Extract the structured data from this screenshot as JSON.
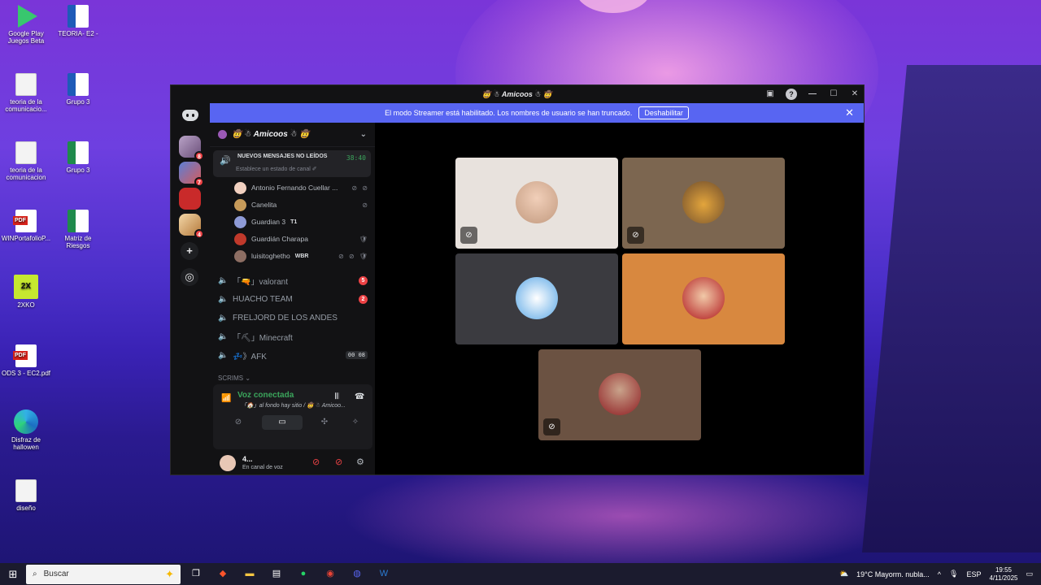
{
  "desktop": {
    "icons": [
      {
        "label": "Google Play Juegos Beta",
        "type": "gplay"
      },
      {
        "label": "TEORIA- E2 -",
        "type": "word"
      },
      {
        "label": "teoria de la comunicacio...",
        "type": "doc"
      },
      {
        "label": "Grupo 3",
        "type": "word"
      },
      {
        "label": "teoria de la comunicacion",
        "type": "doc"
      },
      {
        "label": "Grupo 3",
        "type": "excel"
      },
      {
        "label": "WINPortafolioP...",
        "type": "pdf"
      },
      {
        "label": "Matriz de Riesgos",
        "type": "excel"
      },
      {
        "label": "2XKO",
        "type": "twoxko"
      },
      {
        "label": "ODS 3 - EC2.pdf",
        "type": "pdf"
      },
      {
        "label": "Disfraz de hallowen",
        "type": "edge"
      },
      {
        "label": "diseño",
        "type": "doc"
      }
    ]
  },
  "window": {
    "title": "🤠 ☃ Amicoos ☃ 🤠",
    "streamer_banner": "El modo Streamer está habilitado. Los nombres de usuario se han truncado.",
    "streamer_disable": "Deshabilitar"
  },
  "guilds": {
    "badges": [
      "8",
      "7",
      "4"
    ]
  },
  "server": {
    "name": "🤠 ☃ Amicoos ☃ 🤠",
    "active_voice": {
      "unread_label": "NUEVOS MENSAJES NO LEÍDOS",
      "timer": "38:40",
      "status_hint": "Establece un estado de canal ✐"
    },
    "members": [
      {
        "name": "Antonio Fernando Cuellar ...",
        "tag": "",
        "icons": "⊘ ⊘"
      },
      {
        "name": "Canelita",
        "tag": "",
        "icons": "⊘"
      },
      {
        "name": "Guardian 3",
        "tag": "T1",
        "icons": ""
      },
      {
        "name": "Guardián Charapa",
        "tag": "",
        "icons": "🛡"
      },
      {
        "name": "luisitoghetho",
        "tag": "WBR",
        "icons": "⊘ ⊘ 🛡"
      }
    ],
    "channels": [
      {
        "name": "「🔫」valorant",
        "count": "5"
      },
      {
        "name": "HUACHO TEAM",
        "count": "2"
      },
      {
        "name": "FRELJORD DE LOS ANDES",
        "count": ""
      },
      {
        "name": "「⛏」Minecraft",
        "count": ""
      },
      {
        "name": "💤》AFK",
        "count": "",
        "afk_time": "00 08"
      }
    ],
    "category": "SCRIMS ⌄"
  },
  "voice_panel": {
    "title": "Voz conectada",
    "subtitle": "「🏠」al fondo hay sitio / 🤠 ☃ Amicoo..."
  },
  "user": {
    "name": "4...",
    "status": "En canal de voz"
  },
  "colors": {
    "brand": "#5865f2",
    "connected": "#3ba55c",
    "danger": "#ed4245"
  },
  "taskbar": {
    "search_placeholder": "Buscar",
    "weather": "19°C  Mayorm. nubla...",
    "lang": "ESP",
    "time": "19:55",
    "date": "4/11/2025"
  }
}
